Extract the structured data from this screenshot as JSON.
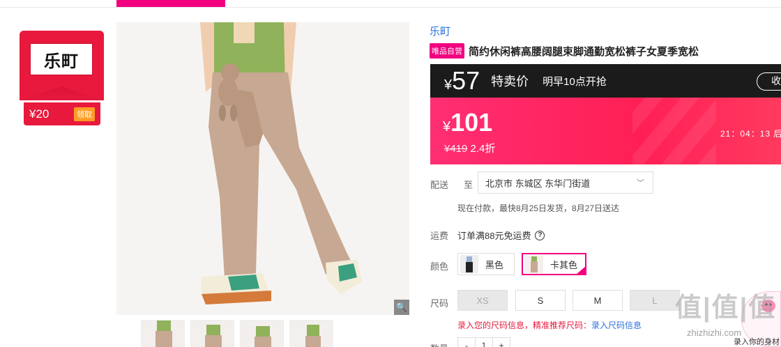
{
  "brand": {
    "logo_text": "乐町",
    "coupon_amount": "¥20",
    "coupon_btn": "领取"
  },
  "product": {
    "brand_link": "乐町",
    "self_tag": "唯品自营",
    "title": "简约休闲裤高腰阔腿束脚通勤宽松裤子女夏季宽松"
  },
  "flash": {
    "currency": "¥",
    "price": "57",
    "label": "特卖价",
    "time": "明早10点开抢",
    "btn": "收"
  },
  "price": {
    "currency": "¥",
    "value": "101",
    "original": "¥419",
    "discount": "2.4折",
    "countdown": "21：04：13 后"
  },
  "delivery": {
    "label": "配送",
    "to": "至",
    "address": "北京市 东城区 东华门街道",
    "note": "现在付款，最快8月25日发货，8月27日送达"
  },
  "freight": {
    "label": "运费",
    "text": "订单满88元免运费",
    "help": "?"
  },
  "color": {
    "label": "颜色",
    "options": [
      {
        "name": "黑色"
      },
      {
        "name": "卡其色"
      }
    ]
  },
  "size": {
    "label": "尺码",
    "options": [
      "XS",
      "S",
      "M",
      "L"
    ],
    "tip": "录入您的尺码信息，精准推荐尺码：",
    "tip_link": "录入尺码信息"
  },
  "quantity": {
    "label": "数量",
    "minus": "-",
    "value": "1",
    "plus": "+"
  },
  "zoom_icon": "🔍",
  "float": {
    "text": "录入你的身材"
  },
  "watermark": {
    "text": "值|值|值",
    "url": "zhizhizhi.com"
  },
  "colors": {
    "accent": "#f10180",
    "price_bar": "#ff1f55",
    "flash_bar": "#1b1b1b"
  }
}
